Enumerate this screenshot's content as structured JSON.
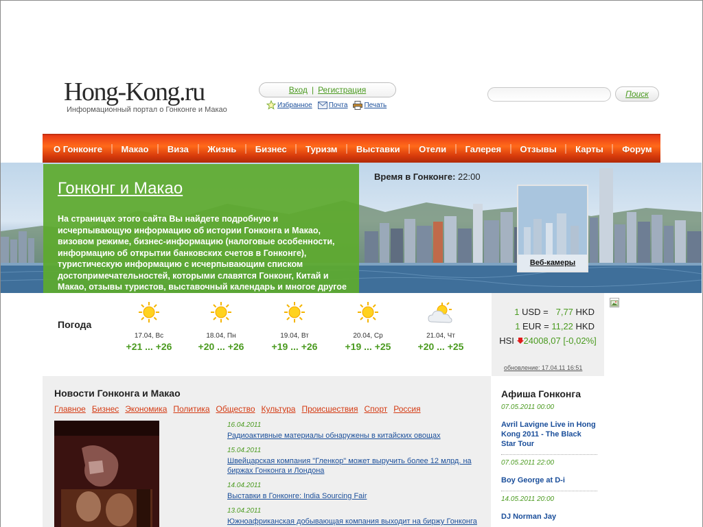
{
  "header": {
    "logo": "Hong-Kong.ru",
    "tagline": "Информационный портал о Гонконге и Макао",
    "login": "Вход",
    "register": "Регистрация",
    "separator": "|",
    "favorites": "Избранное",
    "mail": "Почта",
    "print": "Печать",
    "search_placeholder": "",
    "search_button": "Поиск"
  },
  "nav": [
    "О Гонконге",
    "Макао",
    "Виза",
    "Жизнь",
    "Бизнес",
    "Туризм",
    "Выставки",
    "Отели",
    "Галерея",
    "Отзывы",
    "Карты",
    "Форум"
  ],
  "hero": {
    "title": "Гонконг и Макао",
    "text": "На страницах этого сайта Вы найдете подробную и исчерпывающую информацию об истории Гонконга и Макао, визовом режиме, бизнес-информацию (налоговые особенности, информацию об открытии банковских счетов в Гонконге), туристическую информацию с исчерпывающим списком достопримечательностей, которыми славятся Гонконг, Китай и Макао, отзывы туристов, выставочный календарь и многое другое о Гонконге и Макао.",
    "time_label": "Время в Гонконге:",
    "time_value": "22:00",
    "webcam_label": "Веб-камеры"
  },
  "weather": {
    "label": "Погода",
    "days": [
      {
        "date": "17.04, Вс",
        "temp": "+21 ... +26",
        "icon": "sun-icon"
      },
      {
        "date": "18.04, Пн",
        "temp": "+20 ... +26",
        "icon": "sun-icon"
      },
      {
        "date": "19.04, Вт",
        "temp": "+19 ... +26",
        "icon": "sun-icon"
      },
      {
        "date": "20.04, Ср",
        "temp": "+19 ... +25",
        "icon": "sun-icon"
      },
      {
        "date": "21.04, Чт",
        "temp": "+20 ... +25",
        "icon": "cloud-sun-icon"
      }
    ]
  },
  "currency": {
    "usd": {
      "amount": "1",
      "code": "USD",
      "eq": "=",
      "value": "7,77",
      "unit": "HKD"
    },
    "eur": {
      "amount": "1",
      "code": "EUR",
      "eq": "=",
      "value": "11,22",
      "unit": "HKD"
    },
    "hsi_label": "HSI",
    "hsi_value": "24008,07",
    "hsi_change": "[-0,02%]",
    "updated": "обновление: 17.04.11 16:51"
  },
  "news": {
    "title": "Новости Гонконга и Макао",
    "tabs": [
      "Главное",
      "Бизнес",
      "Экономика",
      "Политика",
      "Общество",
      "Культура",
      "Происшествия",
      "Спорт",
      "Россия"
    ],
    "items": [
      {
        "date": "16.04.2011",
        "title": "Радиоактивные материалы обнаружены в китайских овощах"
      },
      {
        "date": "15.04.2011",
        "title": "Швейцарская компания \"Гленкор\" может выручить более 12 млрд. на биржах Гонконга и Лондона"
      },
      {
        "date": "14.04.2011",
        "title": "Выставки в Гонконге: India Sourcing Fair"
      },
      {
        "date": "13.04.2011",
        "title": "Южноафриканская добывающая компания выходит на биржу Гонконга"
      }
    ]
  },
  "afisha": {
    "title": "Афиша Гонконга",
    "events": [
      {
        "date": "07.05.2011 00:00",
        "title": "Avril Lavigne Live in Hong Kong 2011 - The Black Star Tour"
      },
      {
        "date": "07.05.2011 22:00",
        "title": "Boy George at D-i"
      },
      {
        "date": "14.05.2011 20:00",
        "title": "DJ Norman Jay"
      }
    ]
  }
}
